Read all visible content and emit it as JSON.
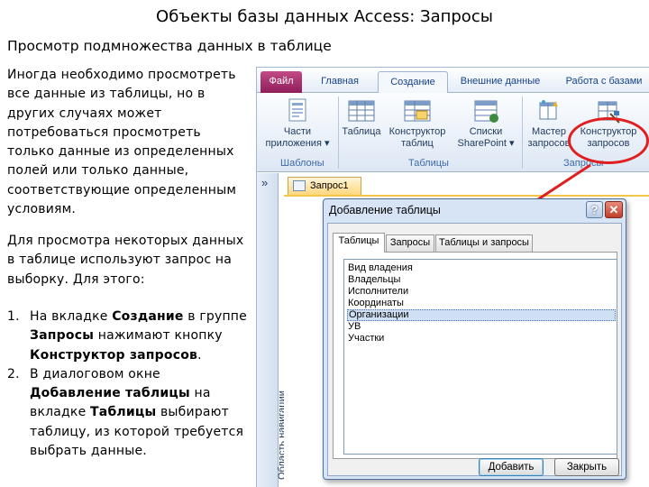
{
  "slide": {
    "title": "Объекты базы данных Access: Запросы",
    "subtitle": "Просмотр подмножества данных в таблице",
    "paragraph1": "Иногда необходимо просмотреть все данные из таблицы, но в других случаях может потребоваться просмотреть только данные из определенных полей или только данные, соответствующие определенным условиям.",
    "paragraph2": "Для просмотра некоторых данных в таблице используют запрос на выборку. Для этого:",
    "steps": [
      {
        "num": "1.",
        "parts": [
          "На вкладке ",
          "Создание",
          " в группе ",
          "Запросы",
          " нажимают кнопку ",
          "Конструктор запросов",
          "."
        ]
      },
      {
        "num": "2.",
        "parts": [
          "В диалоговом окне ",
          "Добавление таблицы",
          " на вкладке ",
          "Таблицы",
          " выбирают таблицу, из которой требуется выбрать данные."
        ]
      }
    ]
  },
  "ribbon": {
    "tabs": [
      "Файл",
      "Главная",
      "Создание",
      "Внешние данные",
      "Работа с базами"
    ],
    "active_tab": "Создание",
    "buttons": {
      "app_parts_1": "Части",
      "app_parts_2": "приложения ▾",
      "table": "Таблица",
      "table_designer_1": "Конструктор",
      "table_designer_2": "таблиц",
      "sp_lists_1": "Списки",
      "sp_lists_2": "SharePoint ▾",
      "query_wizard_1": "Мастер",
      "query_wizard_2": "запросов",
      "query_designer_1": "Конструктор",
      "query_designer_2": "запросов"
    },
    "groups": {
      "templates": "Шаблоны",
      "tables": "Таблицы",
      "queries": "Запросы"
    }
  },
  "workspace": {
    "nav_chevron": "»",
    "nav_label": "Область навигации",
    "doc_tab": "Запрос1"
  },
  "dialog": {
    "title": "Добавление таблицы",
    "help_glyph": "?",
    "close_glyph": "✕",
    "tabs": [
      "Таблицы",
      "Запросы",
      "Таблицы и запросы"
    ],
    "items": [
      "Вид владения",
      "Владельцы",
      "Исполнители",
      "Координаты",
      "Организации",
      "УВ",
      "Участки"
    ],
    "selected_item": "Организации",
    "add_button": "Добавить",
    "close_button": "Закрыть"
  },
  "colors": {
    "file_tab": "#a52a6b",
    "ribbon_text": "#15428b",
    "highlight": "#e02020",
    "selection": "#cfe0f5"
  },
  "icons": [
    "app-parts-icon",
    "table-icon",
    "table-designer-icon",
    "sharepoint-lists-icon",
    "query-wizard-icon",
    "query-designer-icon",
    "query-doc-icon"
  ]
}
